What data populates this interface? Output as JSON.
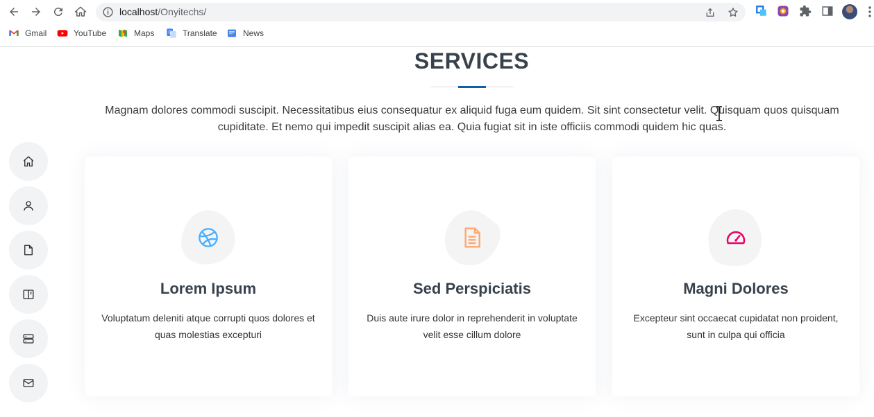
{
  "browser": {
    "url_host": "localhost",
    "url_path": "/Onyitechs/",
    "bookmarks": [
      {
        "label": "Gmail",
        "icon": "gmail-icon"
      },
      {
        "label": "YouTube",
        "icon": "youtube-icon"
      },
      {
        "label": "Maps",
        "icon": "maps-icon"
      },
      {
        "label": "Translate",
        "icon": "translate-icon"
      },
      {
        "label": "News",
        "icon": "news-icon"
      }
    ]
  },
  "services": {
    "title": "SERVICES",
    "intro": "Magnam dolores commodi suscipit. Necessitatibus eius consequatur ex aliquid fuga eum quidem. Sit sint consectetur velit. Quisquam quos quisquam cupiditate. Et nemo qui impedit suscipit alias ea. Quia fugiat sit in iste officiis commodi quidem hic quas.",
    "accent_color": "#0e5fa3",
    "cards": [
      {
        "title": "Lorem Ipsum",
        "desc": "Voluptatum deleniti atque corrupti quos dolores et quas molestias excepturi",
        "icon": "dribbble-icon",
        "color": "#47aeff"
      },
      {
        "title": "Sed Perspiciatis",
        "desc": "Duis aute irure dolor in reprehenderit in voluptate velit esse cillum dolore",
        "icon": "file-text-icon",
        "color": "#ffa76e"
      },
      {
        "title": "Magni Dolores",
        "desc": "Excepteur sint occaecat cupidatat non proident, sunt in culpa qui officia",
        "icon": "speedometer-icon",
        "color": "#e80368"
      }
    ]
  },
  "sidebar": {
    "items": [
      {
        "icon": "home-icon"
      },
      {
        "icon": "person-icon"
      },
      {
        "icon": "file-icon"
      },
      {
        "icon": "book-icon"
      },
      {
        "icon": "server-icon"
      },
      {
        "icon": "envelope-icon"
      }
    ]
  }
}
